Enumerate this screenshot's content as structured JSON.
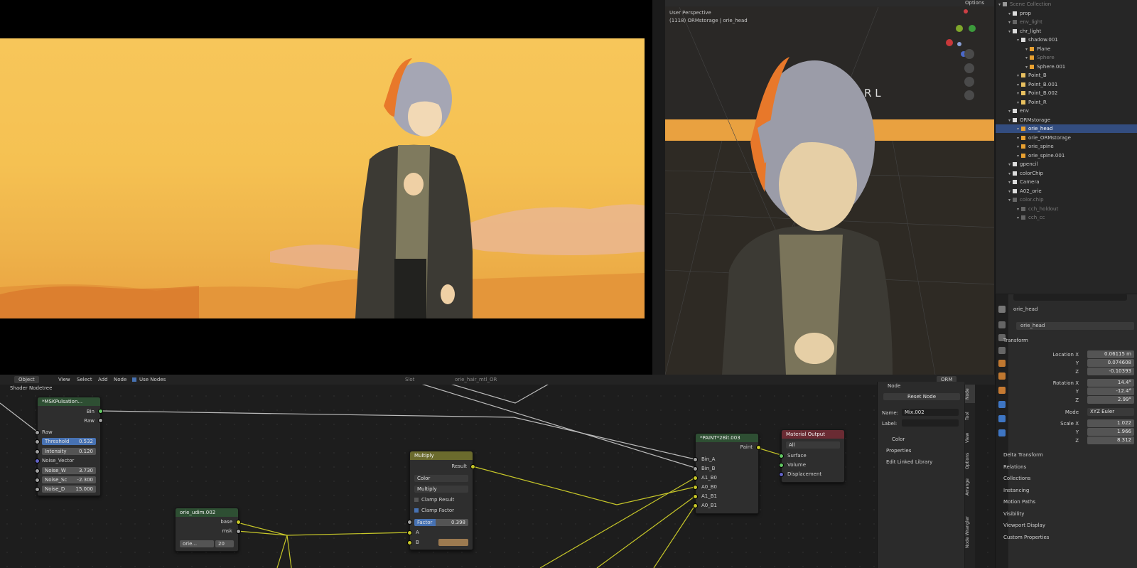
{
  "viewport": {
    "header_label": "Options",
    "overlay_line1": "User Perspective",
    "overlay_line2": "(1118) ORMstorage | orie_head",
    "rl_letters": "R  L"
  },
  "outliner": {
    "rows": [
      {
        "label": "Scene Collection",
        "dim": true
      },
      {
        "label": "prop"
      },
      {
        "label": "env_light",
        "dim": true
      },
      {
        "label": "chr_light"
      },
      {
        "label": "shadow.001"
      },
      {
        "label": "Plane"
      },
      {
        "label": "Sphere",
        "dim": true
      },
      {
        "label": "Sphere.001"
      },
      {
        "label": "Point_B"
      },
      {
        "label": "Point_B.001"
      },
      {
        "label": "Point_B.002"
      },
      {
        "label": "Point_R"
      },
      {
        "label": "env"
      },
      {
        "label": "ORMstorage"
      },
      {
        "label": "orie_head",
        "selected": true
      },
      {
        "label": "orie_ORMstorage"
      },
      {
        "label": "orie_spine"
      },
      {
        "label": "orie_spine.001"
      },
      {
        "label": "gpencil"
      },
      {
        "label": "colorChip"
      },
      {
        "label": "Camera"
      },
      {
        "label": "A02_orie"
      },
      {
        "label": "color.chip",
        "dim": true
      },
      {
        "label": "cch_holdout",
        "dim": true
      },
      {
        "label": "cch_cc",
        "dim": true
      }
    ]
  },
  "properties": {
    "object_name": "orie_head",
    "data_name": "orie_head",
    "transform_label": "Transform",
    "location": {
      "label_x": "Location X",
      "label_y": "Y",
      "label_z": "Z",
      "x": "0.06115 m",
      "y": "0.074608",
      "z": "-0.10393"
    },
    "rotation": {
      "label_x": "Rotation X",
      "label_y": "Y",
      "label_z": "Z",
      "x": "14.4°",
      "y": "-12.4°",
      "z": "2.99°"
    },
    "mode_label": "Mode",
    "mode_value": "XYZ Euler",
    "scale": {
      "label_x": "Scale X",
      "label_y": "Y",
      "label_z": "Z",
      "x": "1.022",
      "y": "1.966",
      "z": "8.312"
    },
    "sections": [
      "Delta Transform",
      "Relations",
      "Collections",
      "Instancing",
      "Motion Paths",
      "Visibility",
      "Viewport Display",
      "Custom Properties"
    ]
  },
  "node_editor": {
    "header": {
      "mode": "Object",
      "menus": [
        "View",
        "Select",
        "Add",
        "Node"
      ],
      "use_nodes": "Use Nodes",
      "slot": "Slot",
      "material": "orie_hair_mtl_OR",
      "orm": "ORM"
    },
    "tree_label": "Shader Nodetree",
    "node_msk": {
      "title": "*MSKPulsation...",
      "out1": "Bin",
      "out2": "Raw",
      "in_raw": "Raw",
      "threshold_label": "Threshold",
      "threshold": "0.532",
      "intensity_label": "Intensity",
      "intensity": "0.120",
      "noise_vector": "Noise_Vector",
      "noise_w_label": "Noise_W",
      "noise_w": "3.730",
      "noise_sc_label": "Noise_Sc",
      "noise_sc": "-2.300",
      "noise_d_label": "Noise_D",
      "noise_d": "15.000"
    },
    "node_udim": {
      "title": "orie_udim.002",
      "out1": "base",
      "out2": "msk",
      "img": "orie...",
      "num": "20"
    },
    "node_multiply": {
      "title": "Multiply",
      "out": "Result",
      "type": "Color",
      "blend": "Multiply",
      "clamp_result": "Clamp Result",
      "clamp_factor": "Clamp Factor",
      "factor_label": "Factor",
      "factor": "0.398",
      "in_a": "A",
      "in_b": "B"
    },
    "node_paint": {
      "title": "*PAINT*2Bit.003",
      "out": "Paint",
      "inputs": [
        "Bin_A",
        "Bin_B",
        "A1_B0",
        "A0_B0",
        "A1_B1",
        "A0_B1"
      ]
    },
    "node_output": {
      "title": "Material Output",
      "target": "All",
      "inputs": [
        "Surface",
        "Volume",
        "Displacement"
      ]
    },
    "npanel": {
      "section": "Node",
      "reset": "Reset Node",
      "name_label": "Name:",
      "name_value": "Mix.002",
      "label_label": "Label:",
      "color": "Color",
      "properties": "Properties",
      "edit_linked": "Edit Linked Library",
      "tabs": [
        "Node",
        "Tool",
        "View",
        "Options",
        "Arrange",
        "Node Wrangler"
      ]
    }
  }
}
